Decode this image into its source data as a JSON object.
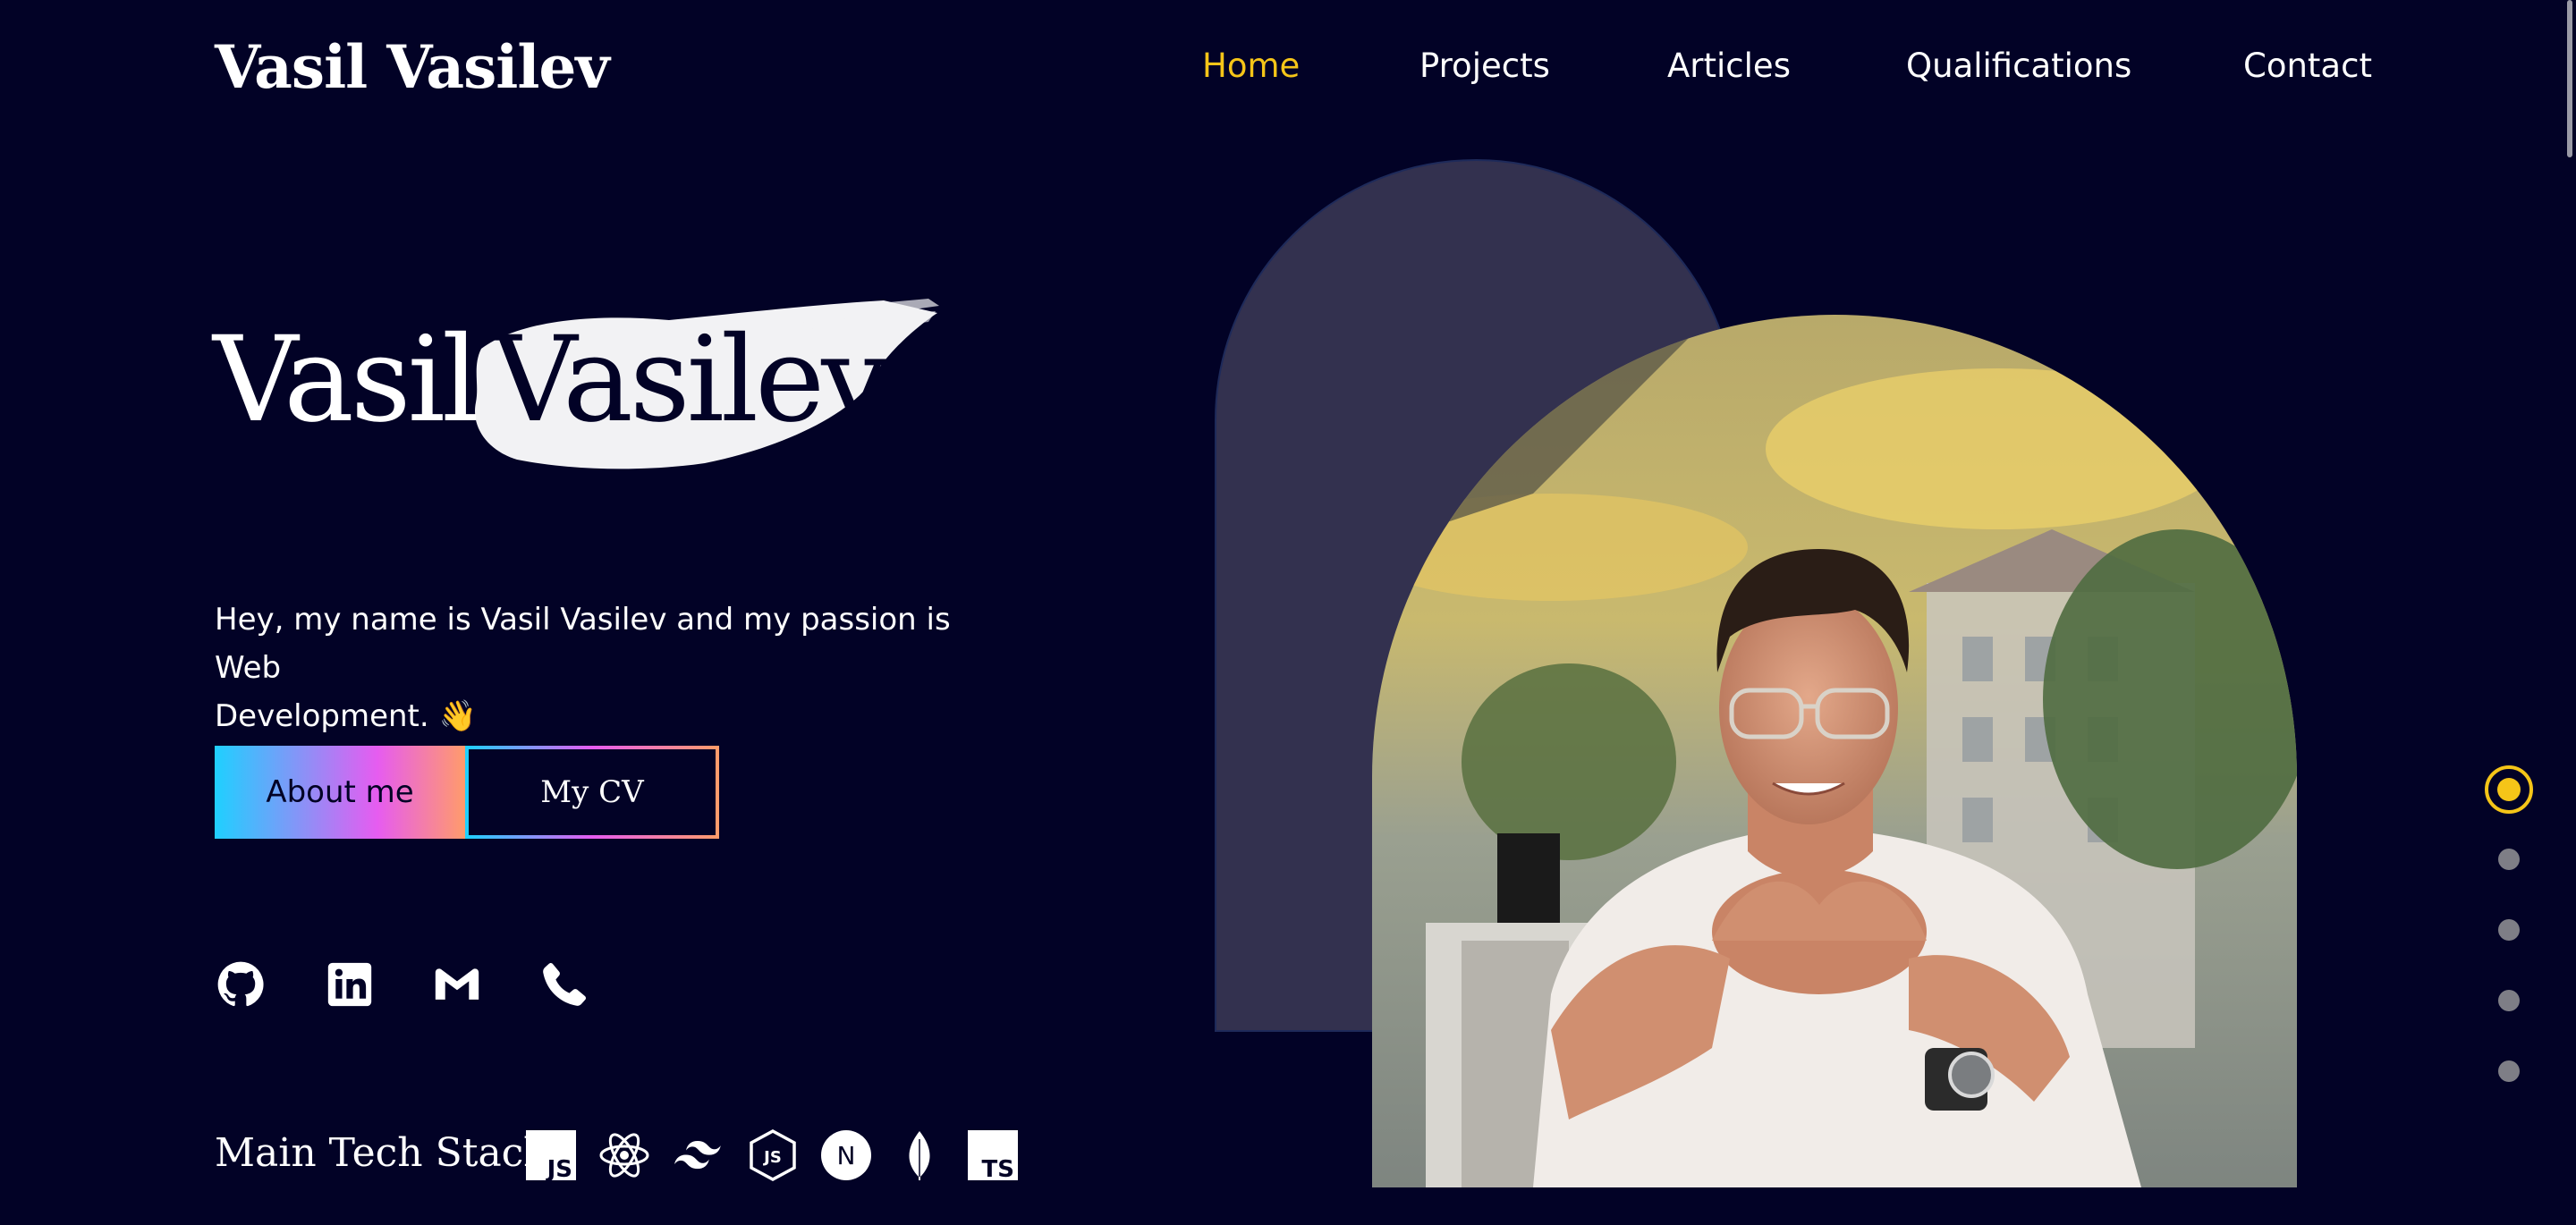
{
  "header": {
    "logo": "Vasil Vasilev",
    "nav": [
      "Home",
      "Projects",
      "Articles",
      "Qualifications",
      "Contact"
    ],
    "active_nav": "Home"
  },
  "hero": {
    "first_name": "Vasil",
    "last_name": "Vasilev",
    "intro_line1": "Hey, my name is Vasil Vasilev and my passion is Web",
    "intro_line2": "Development. 👋",
    "about_button": "About me",
    "cv_button": "My CV"
  },
  "social": {
    "icons": [
      "github-icon",
      "linkedin-icon",
      "gmail-icon",
      "phone-icon"
    ]
  },
  "tech_stack": {
    "label": "Main Tech Stack",
    "js_badge": "JS",
    "ts_badge": "TS",
    "node_badge": "JS",
    "next_badge": "N",
    "icons": [
      "javascript-icon",
      "react-icon",
      "tailwind-icon",
      "nodejs-icon",
      "nextjs-icon",
      "mongodb-icon",
      "typescript-icon"
    ]
  },
  "section_dots": {
    "count": 5,
    "active_index": 0
  },
  "colors": {
    "background": "#020226",
    "accent": "#f5c518",
    "arch": "#33314f",
    "gradient_start": "#1fd0ff",
    "gradient_mid": "#e65cf0",
    "gradient_end": "#ff9b6b"
  }
}
